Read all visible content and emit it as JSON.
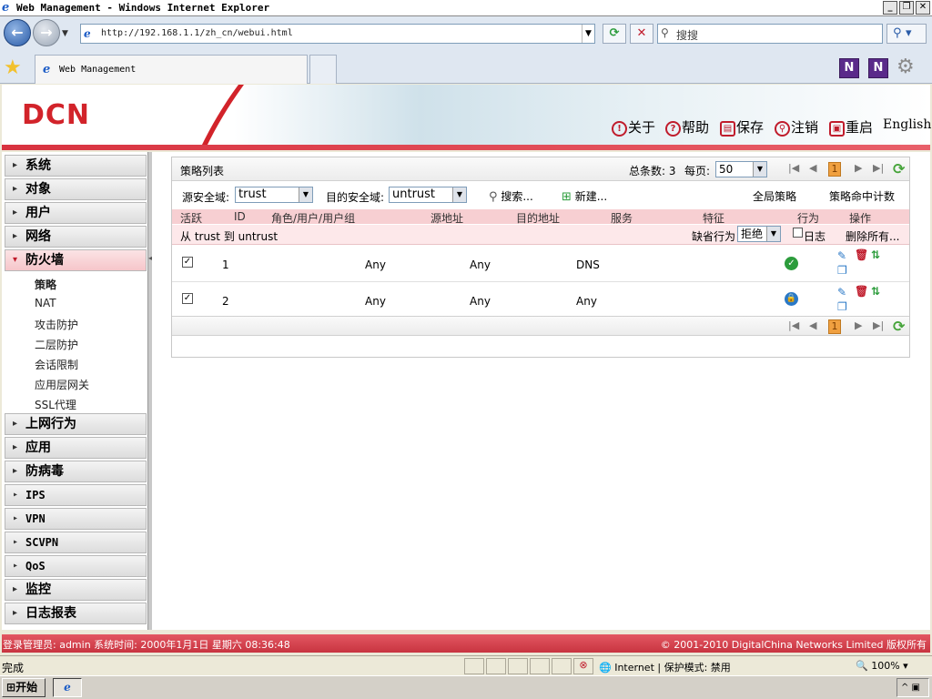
{
  "window": {
    "title": "Web Management - Windows Internet Explorer",
    "url": "http://192.168.1.1/zh_cn/webui.html",
    "search_placeholder": "搜搜",
    "tab_title": "Web Management",
    "status_done": "完成",
    "zone_text": "Internet | 保护模式: 禁用",
    "zoom_text": "100%",
    "start_label": "开始"
  },
  "header": {
    "logo": "DCN",
    "nav": [
      {
        "icon": "!",
        "label": "关于"
      },
      {
        "icon": "?",
        "label": "帮助"
      },
      {
        "icon": "▤",
        "label": "保存"
      },
      {
        "icon": "⚲",
        "label": "注销"
      },
      {
        "icon": "▣",
        "label": "重启"
      },
      {
        "icon": "",
        "label": "English"
      }
    ]
  },
  "sidebar": {
    "menus": [
      {
        "label": "系统"
      },
      {
        "label": "对象"
      },
      {
        "label": "用户"
      },
      {
        "label": "网络"
      },
      {
        "label": "防火墙"
      },
      {
        "label": "上网行为"
      },
      {
        "label": "应用"
      },
      {
        "label": "防病毒"
      },
      {
        "label": "IPS"
      },
      {
        "label": "VPN"
      },
      {
        "label": "SCVPN"
      },
      {
        "label": "QoS"
      },
      {
        "label": "监控"
      },
      {
        "label": "日志报表"
      }
    ],
    "firewall_sub": [
      "策略",
      "NAT",
      "攻击防护",
      "二层防护",
      "会话限制",
      "应用层网关",
      "SSL代理"
    ]
  },
  "policy": {
    "title": "策略列表",
    "total_label": "总条数: 3",
    "per_page_label": "每页:",
    "per_page_value": "50",
    "current_page": "1",
    "src_zone_label": "源安全域:",
    "src_zone_value": "trust",
    "dst_zone_label": "目的安全域:",
    "dst_zone_value": "untrust",
    "search_label": "搜索...",
    "new_label": "新建...",
    "global_policy_label": "全局策略",
    "hit_count_label": "策略命中计数",
    "columns": [
      "活跃",
      "ID",
      "角色/用户/用户组",
      "源地址",
      "目的地址",
      "服务",
      "特征",
      "行为",
      "操作"
    ],
    "zone_row_text": "从 trust 到 untrust",
    "default_action_label": "缺省行为",
    "default_action_value": "拒绝",
    "log_label": "日志",
    "delete_all_label": "删除所有...",
    "rows": [
      {
        "id": "1",
        "src": "Any",
        "dst": "Any",
        "service": "DNS",
        "action": "permit"
      },
      {
        "id": "2",
        "src": "Any",
        "dst": "Any",
        "service": "Any",
        "action": "tunnel"
      }
    ]
  },
  "footer": {
    "left": "登录管理员: admin 系统时间: 2000年1月1日 星期六 08:36:48",
    "right": "© 2001-2010 DigitalChina Networks Limited 版权所有"
  },
  "colors": {
    "brand_red": "#d2232a",
    "header_row_pink": "#f7cfd2",
    "footer_red": "#d8323f"
  }
}
